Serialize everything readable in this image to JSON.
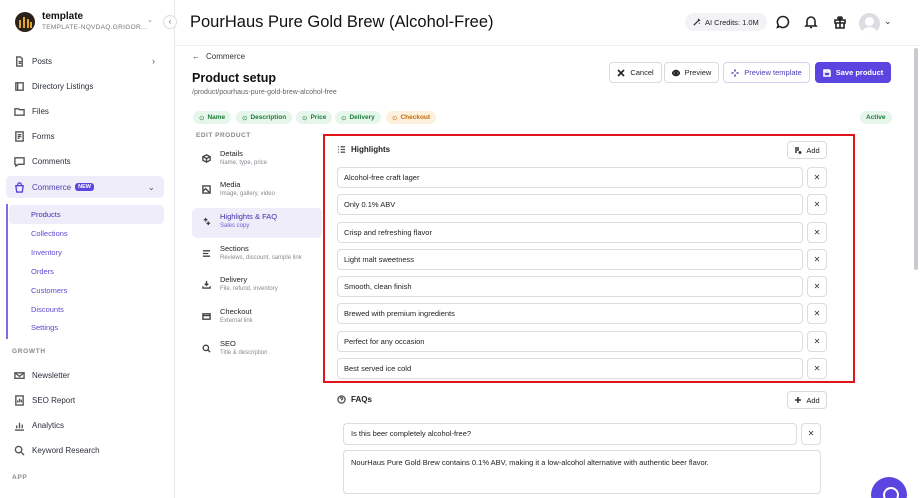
{
  "sidebar": {
    "brand_name": "template",
    "brand_sub": "TEMPLATE-NQVDAQ.GRIGOR...",
    "nav": [
      {
        "label": "Posts",
        "icon": "document-icon"
      },
      {
        "label": "Directory Listings",
        "icon": "book-icon"
      },
      {
        "label": "Files",
        "icon": "folder-icon"
      },
      {
        "label": "Forms",
        "icon": "form-icon"
      },
      {
        "label": "Comments",
        "icon": "comment-icon"
      },
      {
        "label": "Commerce",
        "icon": "shopping-bag-icon",
        "badge": "NEW"
      }
    ],
    "commerce_sub": [
      "Products",
      "Collections",
      "Inventory",
      "Orders",
      "Customers",
      "Discounts",
      "Settings"
    ],
    "growth_label": "GROWTH",
    "growth": [
      {
        "label": "Newsletter",
        "icon": "mail-icon"
      },
      {
        "label": "SEO Report",
        "icon": "report-icon"
      },
      {
        "label": "Analytics",
        "icon": "analytics-icon"
      },
      {
        "label": "Keyword Research",
        "icon": "search-icon"
      }
    ],
    "app_label": "APP"
  },
  "topbar": {
    "title": "PourHaus Pure Gold Brew (Alcohol-Free)",
    "credits": "AI Credits: 1.0M"
  },
  "header": {
    "back": "Commerce",
    "title": "Product setup",
    "slug": "/product/pourhaus-pure-gold-brew-alcohol-free",
    "cancel": "Cancel",
    "preview": "Preview",
    "preview_template": "Preview template",
    "save": "Save product",
    "status": "Active"
  },
  "chips": [
    {
      "label": "Name",
      "state": "ok"
    },
    {
      "label": "Description",
      "state": "ok"
    },
    {
      "label": "Price",
      "state": "ok"
    },
    {
      "label": "Delivery",
      "state": "ok"
    },
    {
      "label": "Checkout",
      "state": "warn"
    }
  ],
  "edit_menu": {
    "heading": "EDIT PRODUCT",
    "items": [
      {
        "title": "Details",
        "sub": "Name, type, price",
        "icon": "box-icon"
      },
      {
        "title": "Media",
        "sub": "Image, gallery, video",
        "icon": "image-icon"
      },
      {
        "title": "Highlights & FAQ",
        "sub": "Sales copy",
        "icon": "sparkle-icon"
      },
      {
        "title": "Sections",
        "sub": "Reviews, discount, sample link",
        "icon": "sections-icon"
      },
      {
        "title": "Delivery",
        "sub": "File, refund, inventory",
        "icon": "download-icon"
      },
      {
        "title": "Checkout",
        "sub": "External link",
        "icon": "card-icon"
      },
      {
        "title": "SEO",
        "sub": "Title & description",
        "icon": "search-icon"
      }
    ]
  },
  "highlights": {
    "title": "Highlights",
    "add": "Add",
    "items": [
      "Alcohol-free craft lager",
      "Only 0.1% ABV",
      "Crisp and refreshing flavor",
      "Light malt sweetness",
      "Smooth, clean finish",
      "Brewed with premium ingredients",
      "Perfect for any occasion",
      "Best served ice cold"
    ]
  },
  "faqs": {
    "title": "FAQs",
    "add": "Add",
    "question": "Is this beer completely alcohol-free?",
    "answer": "NourHaus Pure Gold Brew contains 0.1% ABV, making it a low-alcohol alternative with authentic beer flavor."
  },
  "colors": {
    "accent": "#5a45e0",
    "highlight_border": "#e0141b",
    "success": "#1c7d3a",
    "warning": "#c26a0b"
  }
}
